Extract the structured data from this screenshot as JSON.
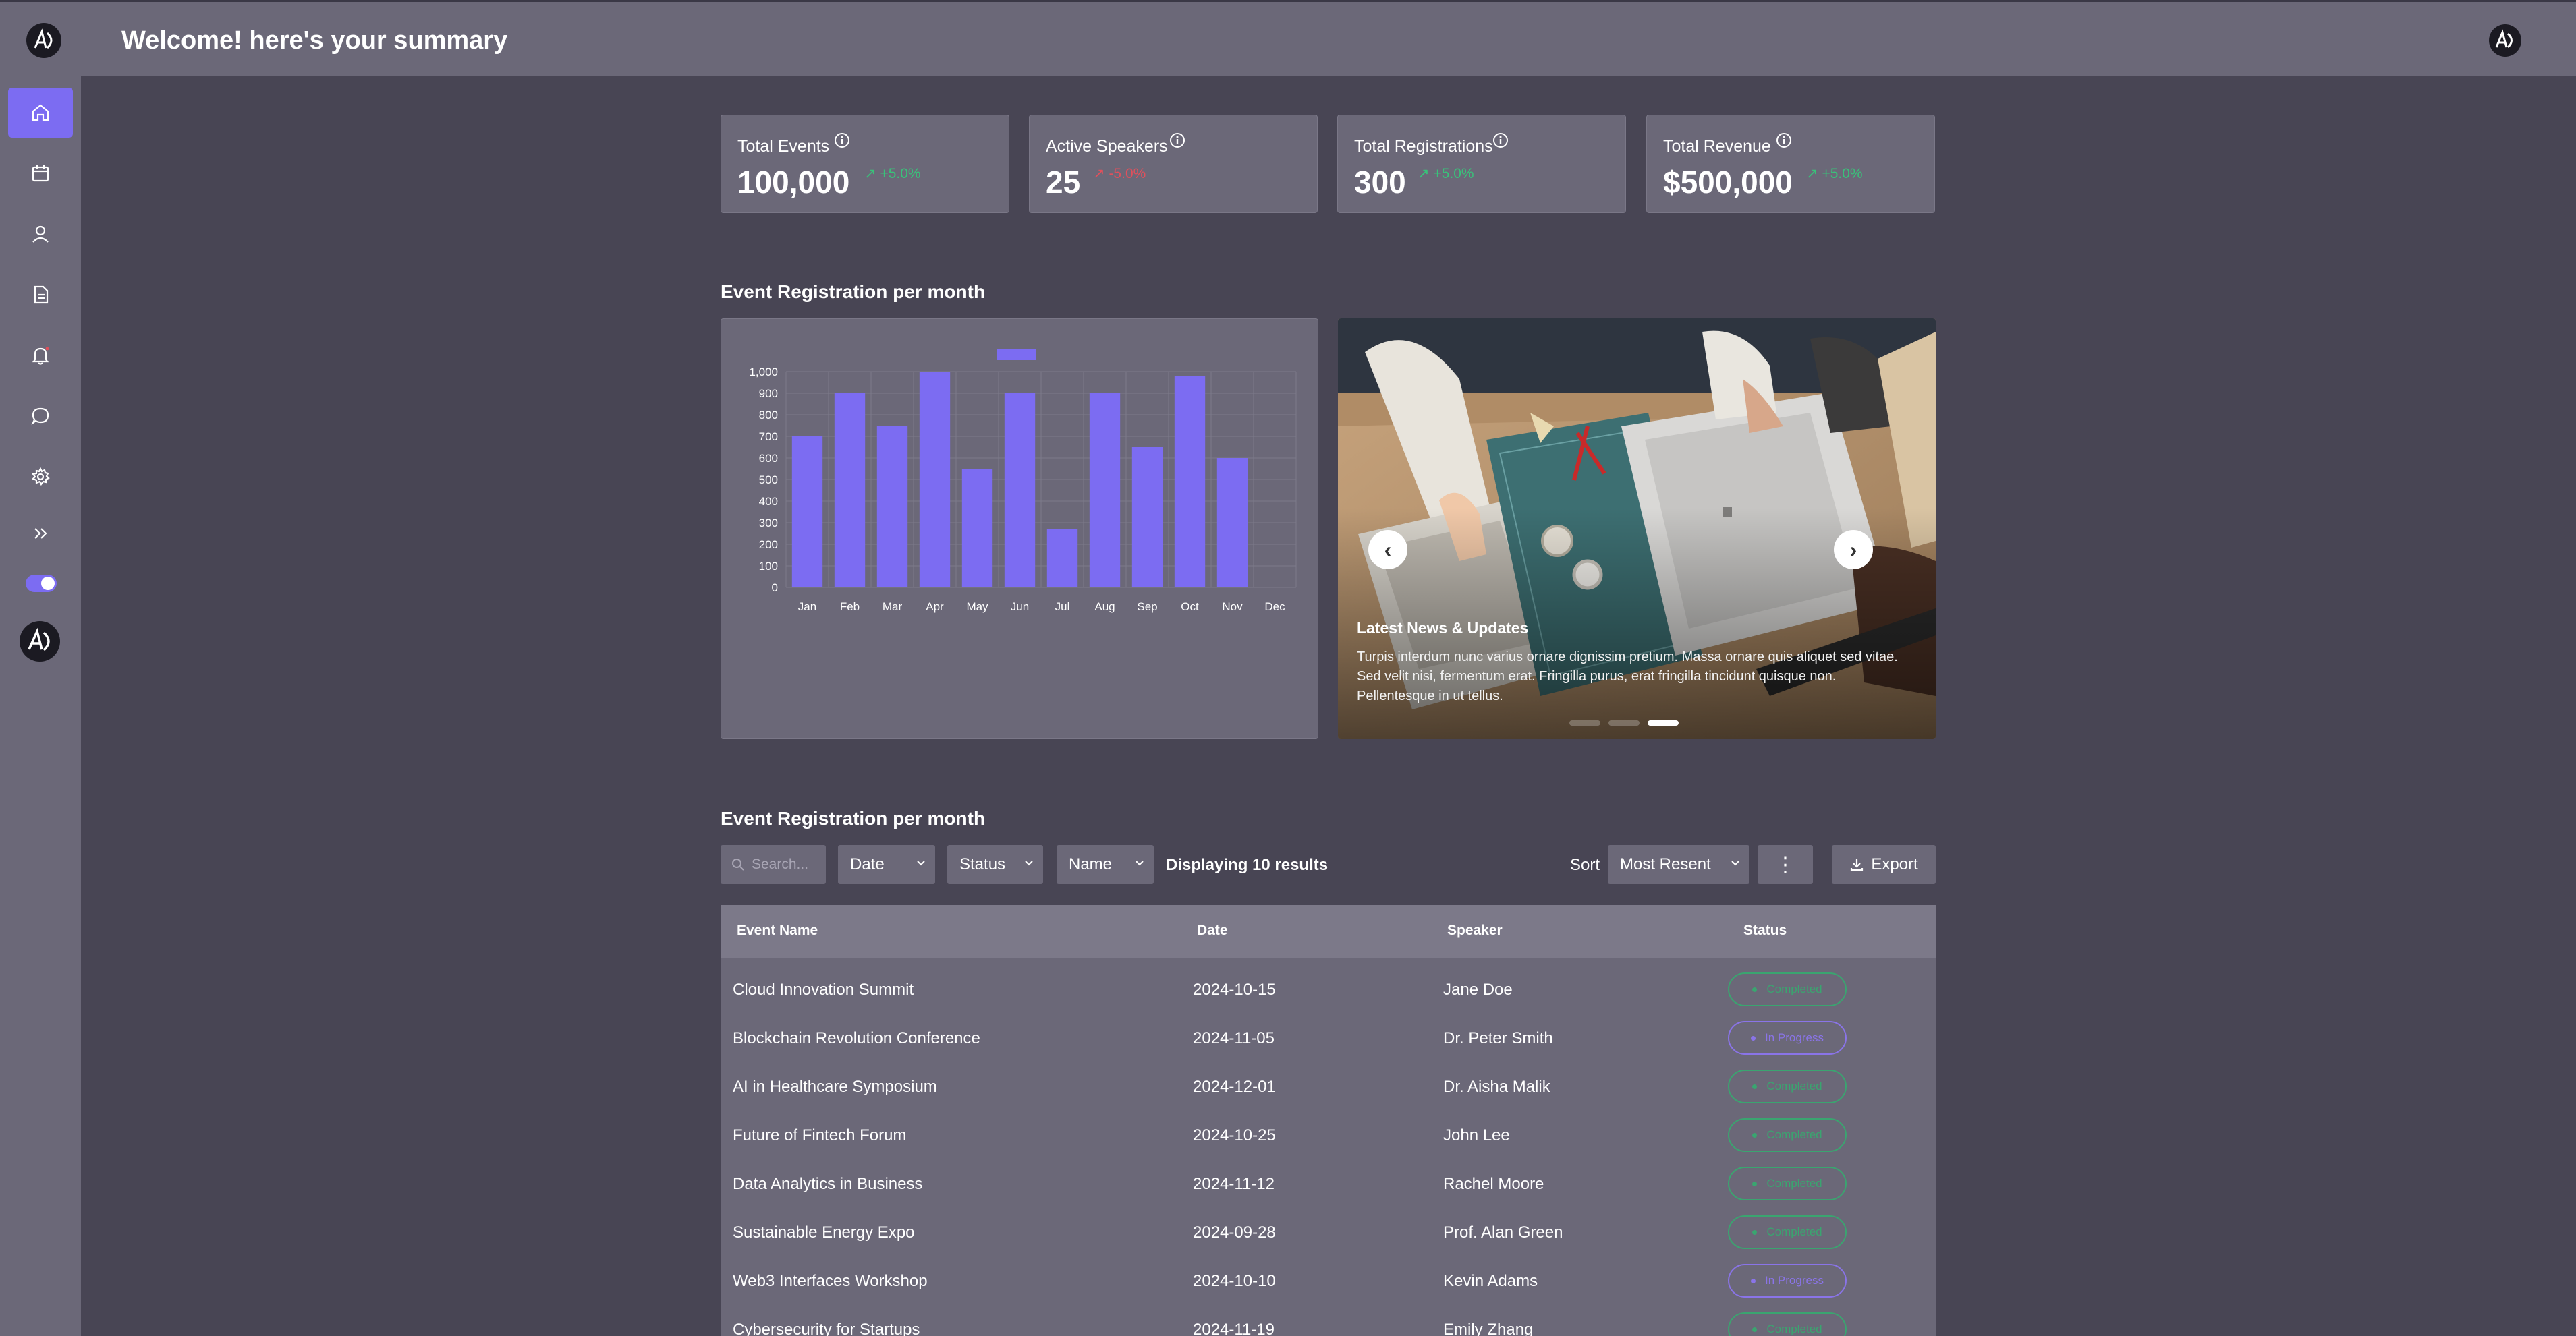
{
  "header": {
    "title": "Welcome! here's your summary"
  },
  "sidebar": {
    "items": [
      {
        "icon": "home-icon",
        "active": true
      },
      {
        "icon": "calendar-icon",
        "active": false
      },
      {
        "icon": "user-icon",
        "active": false
      },
      {
        "icon": "document-icon",
        "active": false
      },
      {
        "icon": "bell-icon",
        "active": false
      },
      {
        "icon": "chat-icon",
        "active": false
      },
      {
        "icon": "gear-icon",
        "active": false
      },
      {
        "icon": "expand-icon",
        "active": false
      }
    ],
    "theme_toggle": "on"
  },
  "stats": [
    {
      "label": "Total Events",
      "value": "100,000",
      "trend": "+5.0%",
      "direction": "up"
    },
    {
      "label": "Active Speakers",
      "value": "25",
      "trend": "-5.0%",
      "direction": "down"
    },
    {
      "label": "Total Registrations",
      "value": "300",
      "trend": "+5.0%",
      "direction": "up"
    },
    {
      "label": "Total Revenue",
      "value": "$500,000",
      "trend": "+5.0%",
      "direction": "up"
    }
  ],
  "chart_section": {
    "title": "Event Registration per month"
  },
  "chart_data": {
    "type": "bar",
    "categories": [
      "Jan",
      "Feb",
      "Mar",
      "Apr",
      "May",
      "Jun",
      "Jul",
      "Aug",
      "Sep",
      "Oct",
      "Nov",
      "Dec"
    ],
    "values": [
      700,
      900,
      750,
      1000,
      550,
      900,
      270,
      900,
      650,
      980,
      600,
      0
    ],
    "ylim": [
      0,
      1000
    ],
    "yticks": [
      "0",
      "100",
      "200",
      "300",
      "400",
      "500",
      "600",
      "700",
      "800",
      "900",
      "1,000"
    ],
    "bar_color": "#7c6cf2",
    "grid": true,
    "legend": "top"
  },
  "carousel": {
    "title": "Latest News & Updates",
    "text": "Turpis interdum nunc varius ornare dignissim pretium. Massa ornare quis aliquet sed vitae. Sed velit nisi, fermentum erat. Fringilla purus, erat fringilla tincidunt quisque non. Pellentesque in ut tellus.",
    "prev": "‹",
    "next": "›",
    "slides": 3,
    "active_slide": 3
  },
  "table_section": {
    "title": "Event Registration per month",
    "search_placeholder": "Search...",
    "filters": [
      "Date",
      "Status",
      "Name"
    ],
    "results_text": "Displaying 10 results",
    "sort_label": "Sort",
    "sort_value": "Most Resent",
    "more": "⋮",
    "export_label": "Export"
  },
  "table": {
    "columns": [
      "Event Name",
      "Date",
      "Speaker",
      "Status"
    ],
    "rows": [
      {
        "name": "Cloud Innovation Summit",
        "date": "2024-10-15",
        "speaker": "Jane Doe",
        "status": "Completed"
      },
      {
        "name": "Blockchain Revolution Conference",
        "date": "2024-11-05",
        "speaker": "Dr. Peter Smith",
        "status": "In Progress"
      },
      {
        "name": "AI in Healthcare Symposium",
        "date": "2024-12-01",
        "speaker": "Dr. Aisha Malik",
        "status": "Completed"
      },
      {
        "name": "Future of Fintech Forum",
        "date": "2024-10-25",
        "speaker": "John Lee",
        "status": "Completed"
      },
      {
        "name": "Data Analytics in Business",
        "date": "2024-11-12",
        "speaker": "Rachel Moore",
        "status": "Completed"
      },
      {
        "name": "Sustainable Energy Expo",
        "date": "2024-09-28",
        "speaker": "Prof. Alan Green",
        "status": "Completed"
      },
      {
        "name": "Web3 Interfaces Workshop",
        "date": "2024-10-10",
        "speaker": "Kevin Adams",
        "status": "In Progress"
      },
      {
        "name": "Cybersecurity for Startups",
        "date": "2024-11-19",
        "speaker": "Emily Zhang",
        "status": "Completed"
      }
    ]
  }
}
